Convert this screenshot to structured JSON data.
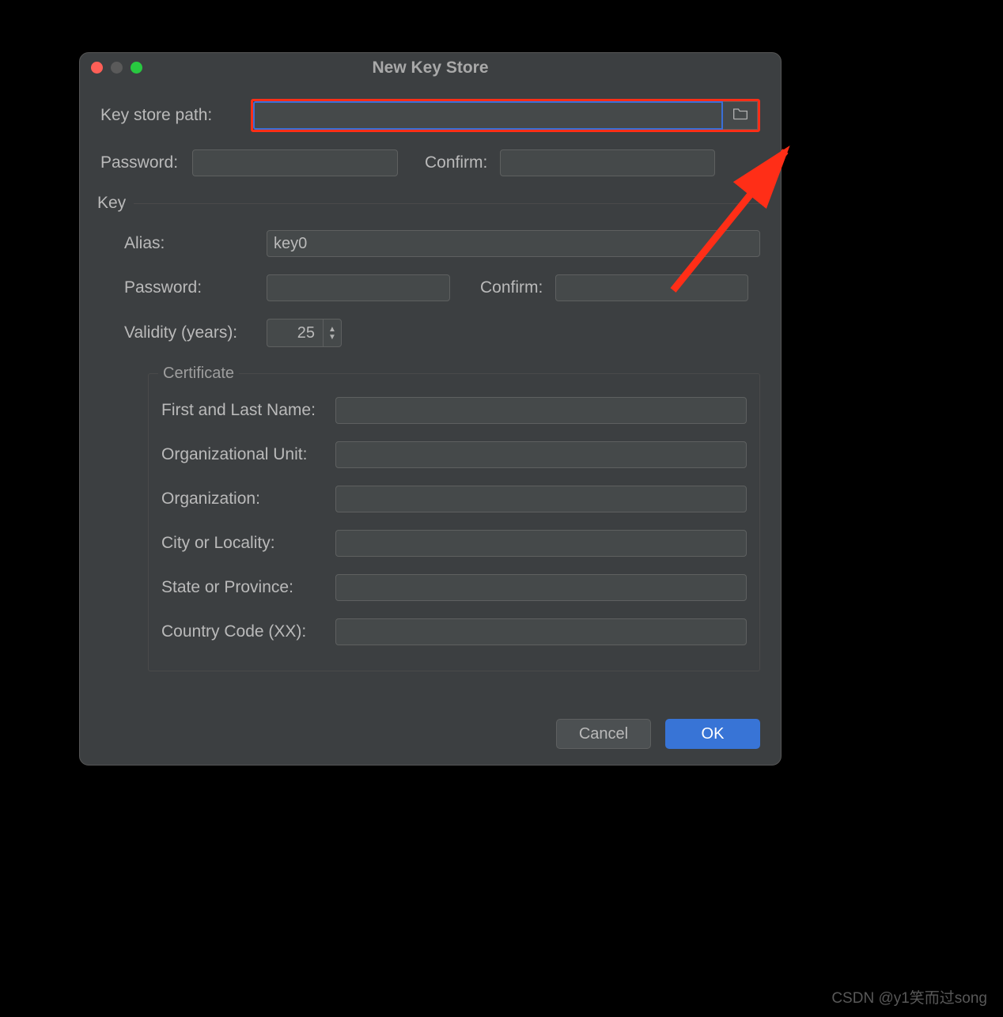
{
  "dialog": {
    "title": "New Key Store",
    "keystore_path_label": "Key store path:",
    "keystore_path_value": "",
    "password_label": "Password:",
    "confirm_label": "Confirm:",
    "password_value": "",
    "confirm_value": ""
  },
  "key_section": {
    "legend": "Key",
    "alias_label": "Alias:",
    "alias_value": "key0",
    "password_label": "Password:",
    "password_value": "",
    "confirm_label": "Confirm:",
    "confirm_value": "",
    "validity_label": "Validity (years):",
    "validity_value": "25"
  },
  "certificate": {
    "legend": "Certificate",
    "first_last_label": "First and Last Name:",
    "first_last_value": "",
    "org_unit_label": "Organizational Unit:",
    "org_unit_value": "",
    "org_label": "Organization:",
    "org_value": "",
    "city_label": "City or Locality:",
    "city_value": "",
    "state_label": "State or Province:",
    "state_value": "",
    "country_label": "Country Code (XX):",
    "country_value": ""
  },
  "buttons": {
    "cancel": "Cancel",
    "ok": "OK"
  },
  "icons": {
    "folder": "folder-icon"
  },
  "annotation": {
    "highlight_color": "#ff2e17",
    "arrow_points_to": "folder-browse-button"
  },
  "watermark": "CSDN @y1笑而过song"
}
